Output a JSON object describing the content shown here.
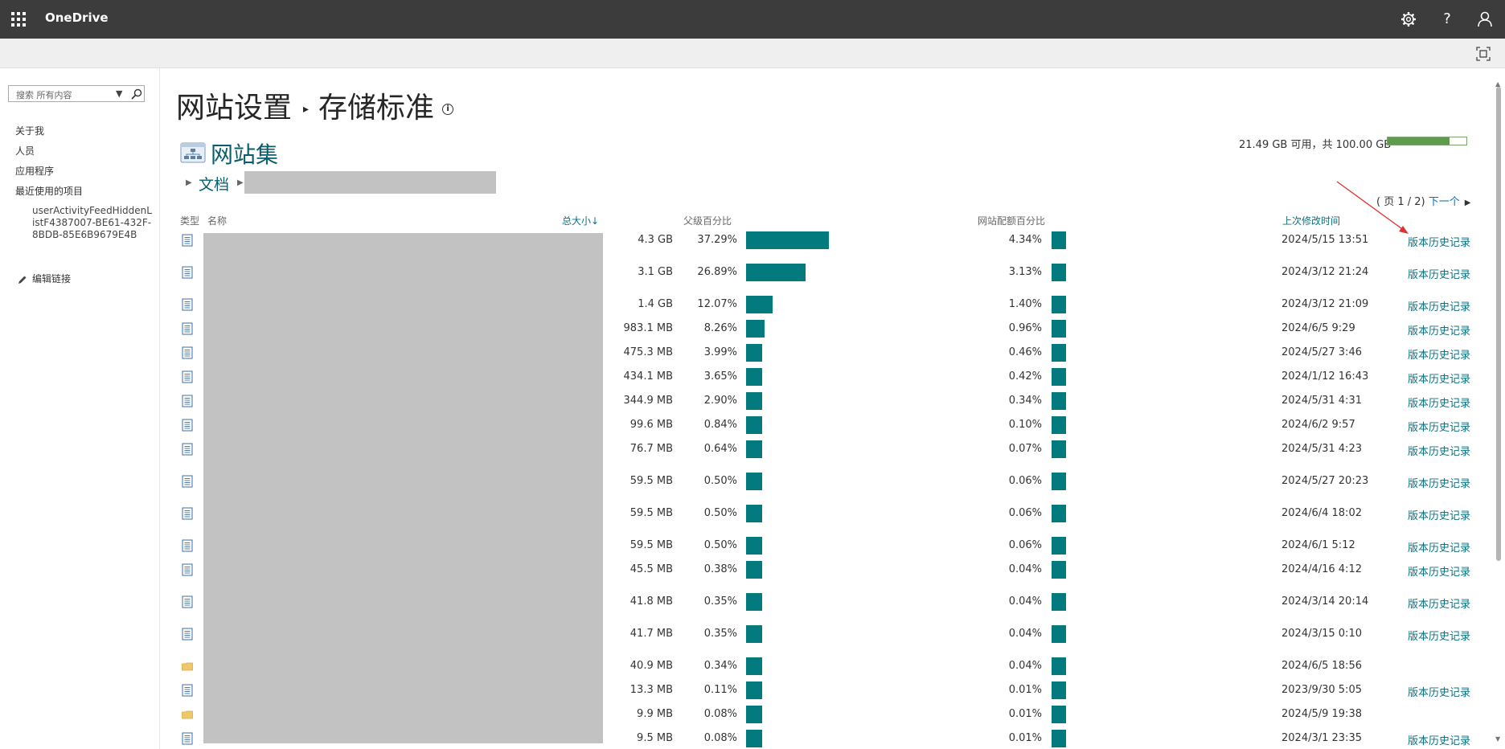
{
  "app": {
    "name": "OneDrive"
  },
  "topbar": {
    "icons": [
      "waffle-icon",
      "gear-icon",
      "help-icon",
      "account-icon"
    ],
    "help_glyph": "?"
  },
  "search": {
    "placeholder": "搜索 所有内容",
    "dropdown_glyph": "▼"
  },
  "sidebar": {
    "items": [
      {
        "label": "关于我"
      },
      {
        "label": "人员"
      },
      {
        "label": "应用程序"
      },
      {
        "label": "最近使用的项目"
      }
    ],
    "recent_sub": "userActivityFeedHiddenListF4387007-BE61-432F-8BDB-85E6B9679E4B",
    "edit_links": "编辑链接"
  },
  "page": {
    "title_part1": "网站设置",
    "title_part2": "存储标准",
    "info_glyph": "i",
    "site_title": "网站集",
    "breadcrumb_doc": "文档"
  },
  "quota": {
    "text": "21.49 GB 可用，共 100.00 GB",
    "used_fraction": 0.785,
    "accent": "#5e9b4e"
  },
  "pager": {
    "text": "( 页 1 / 2)",
    "next": "下一个"
  },
  "table": {
    "headers": {
      "type": "类型",
      "name": "名称",
      "total_size": "总大小",
      "parent_pct": "父级百分比",
      "quota_pct": "网站配额百分比",
      "modified": "上次修改时间"
    },
    "bar_color": "#037a7d",
    "rows": [
      {
        "kind": "doc",
        "size": "4.3 GB",
        "parent_pct": "37.29%",
        "parent_value": 37.29,
        "quota_pct": "4.34%",
        "modified": "2024/5/15 13:51",
        "history": "版本历史记录"
      },
      {
        "kind": "doc",
        "size": "3.1 GB",
        "parent_pct": "26.89%",
        "parent_value": 26.89,
        "quota_pct": "3.13%",
        "modified": "2024/3/12 21:24",
        "history": "版本历史记录"
      },
      {
        "kind": "doc",
        "size": "1.4 GB",
        "parent_pct": "12.07%",
        "parent_value": 12.07,
        "quota_pct": "1.40%",
        "modified": "2024/3/12 21:09",
        "history": "版本历史记录"
      },
      {
        "kind": "doc",
        "size": "983.1 MB",
        "parent_pct": "8.26%",
        "parent_value": 8.26,
        "quota_pct": "0.96%",
        "modified": "2024/6/5 9:29",
        "history": "版本历史记录"
      },
      {
        "kind": "doc",
        "size": "475.3 MB",
        "parent_pct": "3.99%",
        "parent_value": 3.99,
        "quota_pct": "0.46%",
        "modified": "2024/5/27 3:46",
        "history": "版本历史记录"
      },
      {
        "kind": "doc",
        "size": "434.1 MB",
        "parent_pct": "3.65%",
        "parent_value": 3.65,
        "quota_pct": "0.42%",
        "modified": "2024/1/12 16:43",
        "history": "版本历史记录"
      },
      {
        "kind": "doc",
        "size": "344.9 MB",
        "parent_pct": "2.90%",
        "parent_value": 2.9,
        "quota_pct": "0.34%",
        "modified": "2024/5/31 4:31",
        "history": "版本历史记录"
      },
      {
        "kind": "doc",
        "size": "99.6 MB",
        "parent_pct": "0.84%",
        "parent_value": 0.84,
        "quota_pct": "0.10%",
        "modified": "2024/6/2 9:57",
        "history": "版本历史记录"
      },
      {
        "kind": "doc",
        "size": "76.7 MB",
        "parent_pct": "0.64%",
        "parent_value": 0.64,
        "quota_pct": "0.07%",
        "modified": "2024/5/31 4:23",
        "history": "版本历史记录"
      },
      {
        "kind": "doc",
        "size": "59.5 MB",
        "parent_pct": "0.50%",
        "parent_value": 0.5,
        "quota_pct": "0.06%",
        "modified": "2024/5/27 20:23",
        "history": "版本历史记录"
      },
      {
        "kind": "doc",
        "size": "59.5 MB",
        "parent_pct": "0.50%",
        "parent_value": 0.5,
        "quota_pct": "0.06%",
        "modified": "2024/6/4 18:02",
        "history": "版本历史记录"
      },
      {
        "kind": "doc",
        "size": "59.5 MB",
        "parent_pct": "0.50%",
        "parent_value": 0.5,
        "quota_pct": "0.06%",
        "modified": "2024/6/1 5:12",
        "history": "版本历史记录"
      },
      {
        "kind": "doc",
        "size": "45.5 MB",
        "parent_pct": "0.38%",
        "parent_value": 0.38,
        "quota_pct": "0.04%",
        "modified": "2024/4/16 4:12",
        "history": "版本历史记录"
      },
      {
        "kind": "doc",
        "size": "41.8 MB",
        "parent_pct": "0.35%",
        "parent_value": 0.35,
        "quota_pct": "0.04%",
        "modified": "2024/3/14 20:14",
        "history": "版本历史记录"
      },
      {
        "kind": "doc",
        "size": "41.7 MB",
        "parent_pct": "0.35%",
        "parent_value": 0.35,
        "quota_pct": "0.04%",
        "modified": "2024/3/15 0:10",
        "history": "版本历史记录"
      },
      {
        "kind": "folder",
        "size": "40.9 MB",
        "parent_pct": "0.34%",
        "parent_value": 0.34,
        "quota_pct": "0.04%",
        "modified": "2024/6/5 18:56",
        "history": ""
      },
      {
        "kind": "doc",
        "size": "13.3 MB",
        "parent_pct": "0.11%",
        "parent_value": 0.11,
        "quota_pct": "0.01%",
        "modified": "2023/9/30 5:05",
        "history": "版本历史记录"
      },
      {
        "kind": "folder",
        "size": "9.9 MB",
        "parent_pct": "0.08%",
        "parent_value": 0.08,
        "quota_pct": "0.01%",
        "modified": "2024/5/9 19:38",
        "history": ""
      },
      {
        "kind": "doc",
        "size": "9.5 MB",
        "parent_pct": "0.08%",
        "parent_value": 0.08,
        "quota_pct": "0.01%",
        "modified": "2024/3/1 23:35",
        "history": "版本历史记录"
      }
    ]
  }
}
